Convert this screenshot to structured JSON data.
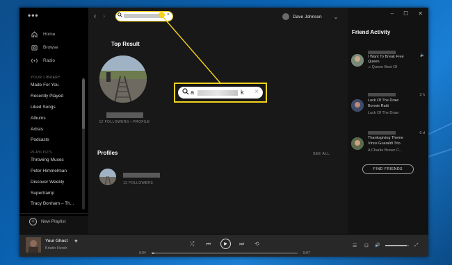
{
  "app": {
    "menu_dots": "•••"
  },
  "sidebar": {
    "nav": [
      {
        "label": "Home",
        "icon": "home-icon"
      },
      {
        "label": "Browse",
        "icon": "browse-icon"
      },
      {
        "label": "Radio",
        "icon": "radio-icon"
      }
    ],
    "library_title": "YOUR LIBRARY",
    "library": [
      "Made For You",
      "Recently Played",
      "Liked Songs",
      "Albums",
      "Artists",
      "Podcasts"
    ],
    "playlists_title": "PLAYLISTS",
    "playlists": [
      "Throwing Muses",
      "Peter Himmelman",
      "Discover Weekly",
      "Supertramp",
      "Tracy Bonham – Th..."
    ],
    "new_playlist": "New Playlist"
  },
  "header": {
    "back": "‹",
    "forward": "›",
    "search_value": "a",
    "user_name": "Dave Johnson",
    "chevron": "⌄"
  },
  "main": {
    "top_result_title": "Top Result",
    "top_result_meta": "12 FOLLOWERS • PROFILE",
    "profiles_title": "Profiles",
    "see_all": "SEE ALL",
    "profile_meta": "12 FOLLOWERS"
  },
  "callout": {
    "search_value": "a",
    "caret": "k",
    "clear": "×",
    "search_icon": "⚲"
  },
  "window": {
    "minimize": "–",
    "maximize": "☐",
    "close": "✕"
  },
  "friends": {
    "title": "Friend Activity",
    "items": [
      {
        "song": "I Want To Break Free",
        "artist": "Queen",
        "source": "♫ Queen Best Of",
        "time": ""
      },
      {
        "song": "Luck Of The Draw",
        "artist": "Bonnie Raitt",
        "source": "Luck Of The Draw",
        "time": "3 h"
      },
      {
        "song": "Thanksgiving Theme",
        "artist": "Vince Guaraldi Trio",
        "source": "A Charlie Brown C...",
        "time": "6 d"
      }
    ],
    "find_friends": "FIND FRIENDS"
  },
  "player": {
    "title": "Your Ghost",
    "artist": "Kristin Hersh",
    "elapsed": "0:04",
    "duration": "5:07",
    "progress": 0.02,
    "volume": 0.9,
    "icons": {
      "heart": "♥",
      "shuffle": "⤮",
      "prev": "⏮",
      "play": "▶",
      "next": "⏭",
      "repeat": "⟲",
      "queue": "☰",
      "device": "⊡",
      "volume": "🔊",
      "fullscreen": "⤢"
    }
  },
  "colors": {
    "accent": "#f5d31b",
    "background": "#121212",
    "panel": "#181818",
    "player": "#282828"
  }
}
